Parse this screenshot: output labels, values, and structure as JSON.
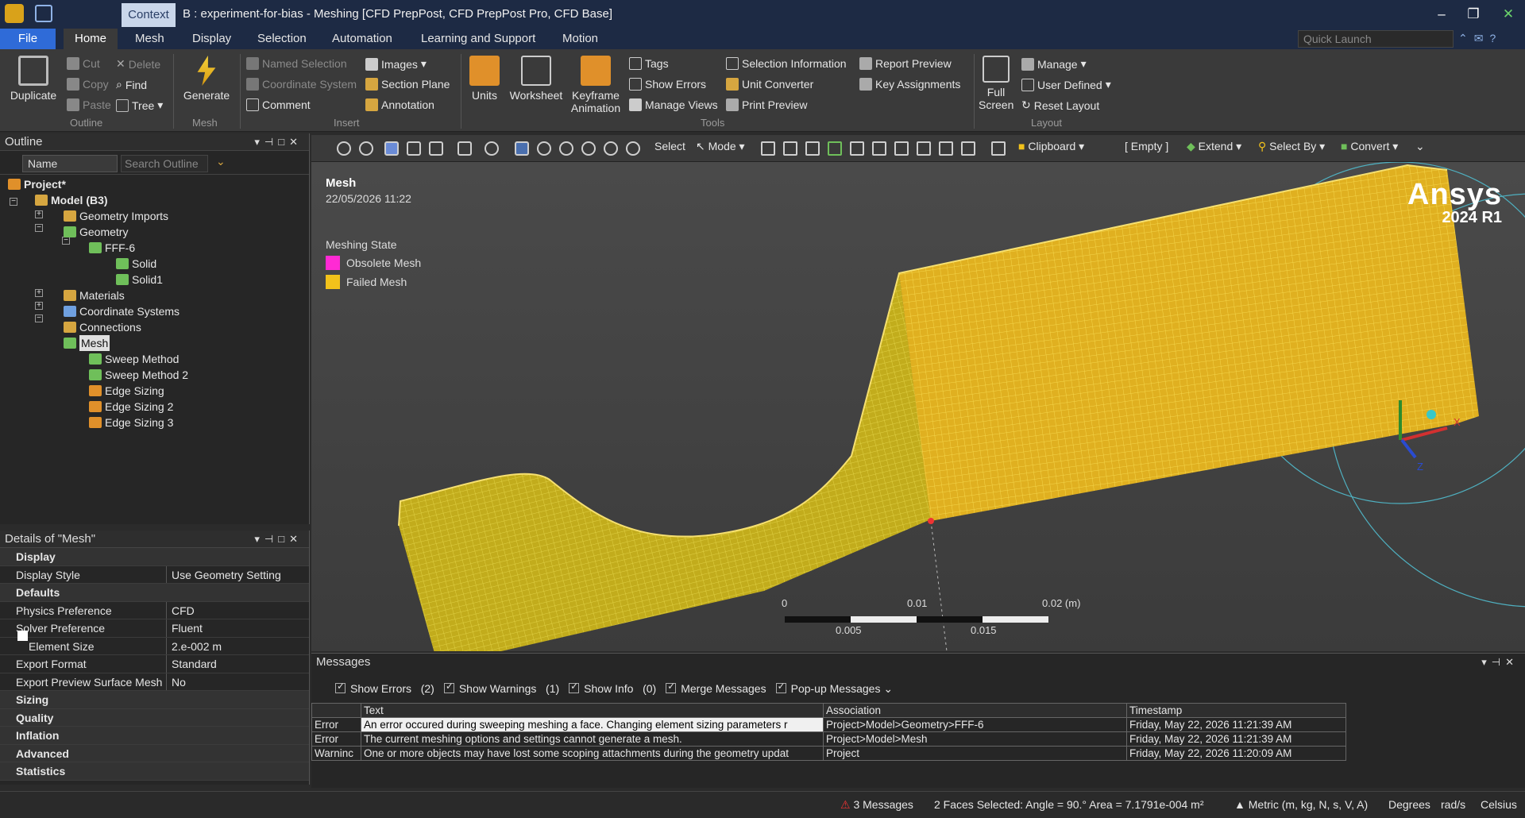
{
  "title": {
    "context": "Context",
    "text": "B : experiment-for-bias - Meshing [CFD PrepPost, CFD PrepPost Pro, CFD Base]"
  },
  "menu": [
    "File",
    "Home",
    "Mesh",
    "Display",
    "Selection",
    "Automation",
    "Learning and Support",
    "Motion"
  ],
  "quick_launch_placeholder": "Quick Launch",
  "ribbon": {
    "outline_group": {
      "duplicate": "Duplicate",
      "cut": "Cut",
      "copy": "Copy",
      "paste": "Paste",
      "delete": "Delete",
      "find": "Find",
      "tree": "Tree",
      "label": "Outline"
    },
    "mesh_group": {
      "generate": "Generate",
      "label": "Mesh"
    },
    "insert_group": {
      "named_selection": "Named Selection",
      "coordinate_system": "Coordinate System",
      "comment": "Comment",
      "images": "Images",
      "section_plane": "Section Plane",
      "annotation": "Annotation",
      "label": "Insert"
    },
    "tools_group": {
      "units": "Units",
      "worksheet": "Worksheet",
      "keyframe": "Keyframe",
      "animation": "Animation",
      "tags": "Tags",
      "show_errors": "Show Errors",
      "manage_views": "Manage Views",
      "selection_information": "Selection Information",
      "unit_converter": "Unit Converter",
      "print_preview": "Print Preview",
      "report_preview": "Report Preview",
      "key_assignments": "Key Assignments",
      "label": "Tools"
    },
    "layout_group": {
      "full": "Full",
      "screen": "Screen",
      "manage": "Manage",
      "user_defined": "User Defined",
      "reset_layout": "Reset Layout",
      "label": "Layout"
    }
  },
  "outline": {
    "header": "Outline",
    "name_filter": "Name",
    "search_placeholder": "Search Outline",
    "nodes": [
      "Project*",
      "Model (B3)",
      "Geometry Imports",
      "Geometry",
      "FFF-6",
      "Solid",
      "Solid1",
      "Materials",
      "Coordinate Systems",
      "Connections",
      "Mesh",
      "Sweep Method",
      "Sweep Method 2",
      "Edge Sizing",
      "Edge Sizing 2",
      "Edge Sizing 3"
    ]
  },
  "details": {
    "header": "Details of \"Mesh\"",
    "rows": [
      {
        "k": "Display",
        "cat": true
      },
      {
        "k": "Display Style",
        "v": "Use Geometry Setting"
      },
      {
        "k": "Defaults",
        "cat": true
      },
      {
        "k": "Physics Preference",
        "v": "CFD"
      },
      {
        "k": "Solver Preference",
        "v": "Fluent"
      },
      {
        "k": "Element Size",
        "v": "2.e-002 m"
      },
      {
        "k": "Export Format",
        "v": "Standard"
      },
      {
        "k": "Export Preview Surface Mesh",
        "v": "No"
      },
      {
        "k": "Sizing",
        "cat": true
      },
      {
        "k": "Quality",
        "cat": true
      },
      {
        "k": "Inflation",
        "cat": true
      },
      {
        "k": "Advanced",
        "cat": true
      },
      {
        "k": "Statistics",
        "cat": true
      }
    ]
  },
  "toolbar": {
    "select": "Select",
    "mode": "Mode",
    "clipboard": "Clipboard",
    "empty": "[ Empty ]",
    "extend": "Extend",
    "select_by": "Select By",
    "convert": "Convert"
  },
  "viewport": {
    "title": "Mesh",
    "date": "22/05/2026 11:22",
    "legend_title": "Meshing State",
    "legend": [
      {
        "label": "Obsolete Mesh",
        "color": "#ff2ad4"
      },
      {
        "label": "Failed Mesh",
        "color": "#f2c21b"
      }
    ],
    "brand": "Ansys",
    "version": "2024 R1",
    "scale": {
      "t0": "0",
      "t1": "0.01",
      "t2": "0.02 (m)",
      "b1": "0.005",
      "b2": "0.015"
    }
  },
  "messages": {
    "header": "Messages",
    "options": [
      "Show Errors",
      "(2)",
      "Show Warnings",
      "(1)",
      "Show Info",
      "(0)",
      "Merge Messages",
      "Pop-up Messages"
    ],
    "columns": [
      "",
      "Text",
      "Association",
      "Timestamp"
    ],
    "rows": [
      [
        "Error",
        "An error occured during sweeping meshing a face. Changing element sizing parameters r",
        "Project>Model>Geometry>FFF-6",
        "Friday, May 22, 2026 11:21:39 AM"
      ],
      [
        "Error",
        "The current meshing options and settings cannot generate a mesh.",
        "Project>Model>Mesh",
        "Friday, May 22, 2026 11:21:39 AM"
      ],
      [
        "Warninc",
        "One or more objects may have lost some scoping attachments during the geometry updat",
        "Project",
        "Friday, May 22, 2026 11:20:09 AM"
      ]
    ]
  },
  "status": {
    "messages": "3 Messages",
    "selection": "2 Faces Selected: Angle = 90.°  Area = 7.1791e-004 m²",
    "units": "Metric (m, kg, N, s, V, A)",
    "degrees": "Degrees",
    "rads": "rad/s",
    "celsius": "Celsius"
  }
}
